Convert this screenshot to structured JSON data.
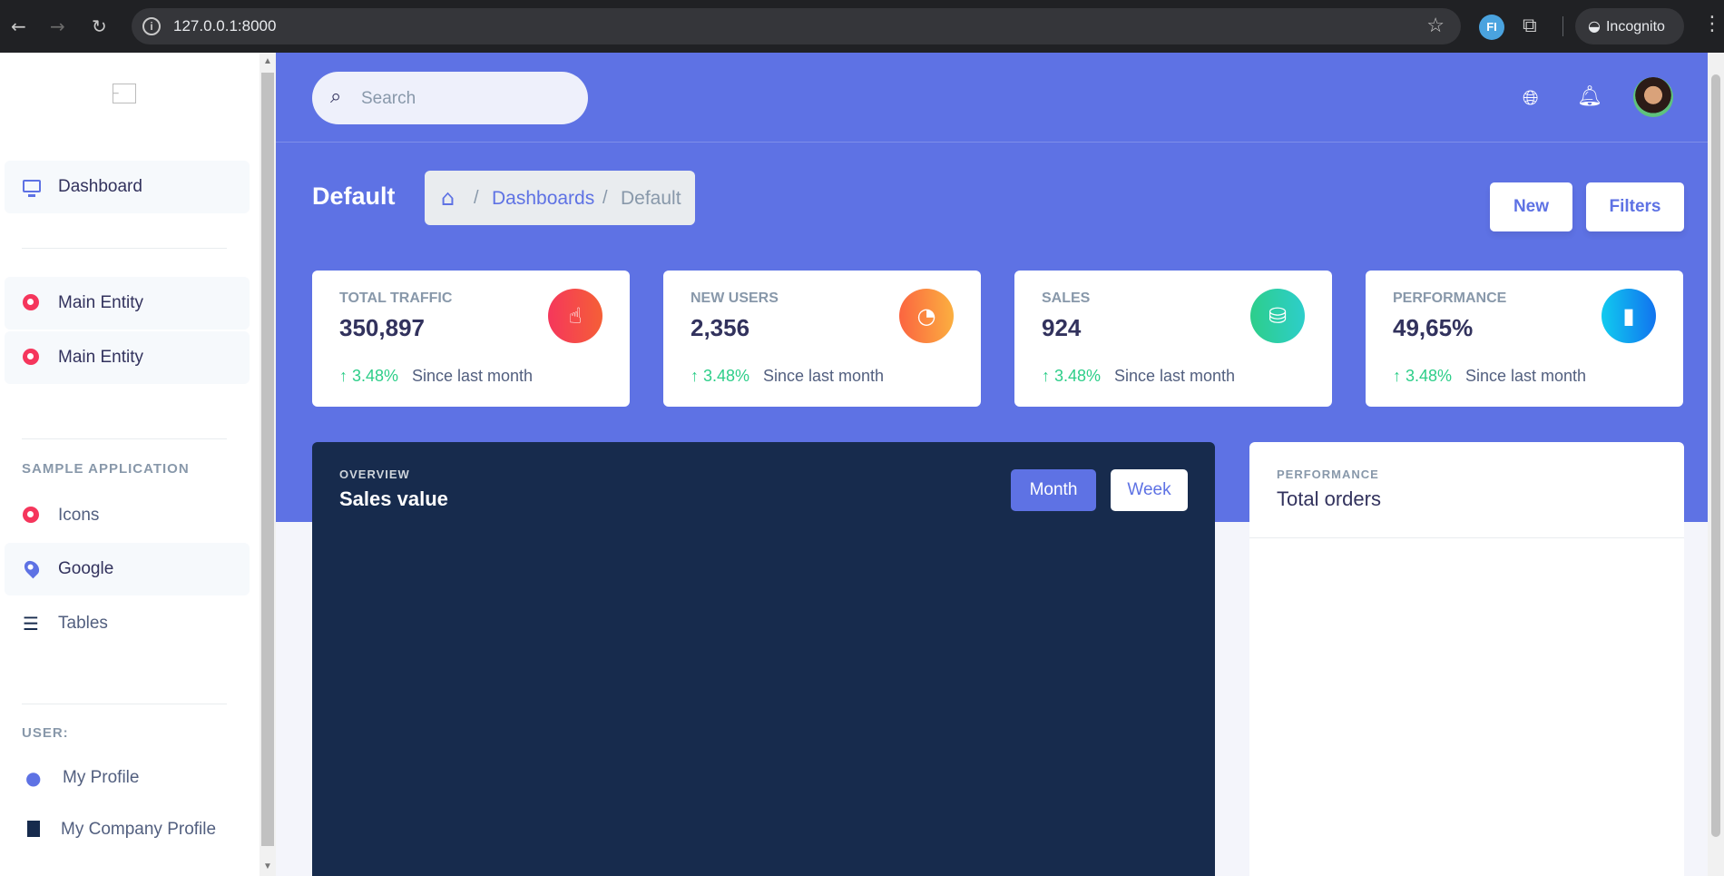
{
  "browser": {
    "url": "127.0.0.1:8000",
    "incognito_label": "Incognito",
    "extension_label": "FI"
  },
  "sidebar": {
    "logo_alt": "_",
    "items_top": [
      {
        "label": "Dashboard",
        "icon": "monitor-icon"
      }
    ],
    "entities": [
      {
        "label": "Main Entity",
        "icon": "entity-icon"
      },
      {
        "label": "Main Entity",
        "icon": "entity-icon"
      }
    ],
    "sample_heading": "SAMPLE APPLICATION",
    "sample_items": [
      {
        "label": "Icons",
        "icon": "entity-icon"
      },
      {
        "label": "Google",
        "icon": "map-pin-icon"
      },
      {
        "label": "Tables",
        "icon": "list-icon"
      }
    ],
    "user_heading": "USER:",
    "user_items": [
      {
        "label": "My Profile",
        "icon": "user-icon"
      },
      {
        "label": "My Company Profile",
        "icon": "building-icon"
      }
    ]
  },
  "topbar": {
    "search_placeholder": "Search"
  },
  "header": {
    "title": "Default",
    "breadcrumb": [
      "Dashboards",
      "Default"
    ],
    "new_label": "New",
    "filters_label": "Filters"
  },
  "stats": [
    {
      "title": "TOTAL TRAFFIC",
      "value": "350,897",
      "change": "3.48%",
      "since": "Since last month",
      "icon": "hand-pointer-icon",
      "color": "#f5365c"
    },
    {
      "title": "NEW USERS",
      "value": "2,356",
      "change": "3.48%",
      "since": "Since last month",
      "icon": "pie-chart-icon",
      "color": "#fb6340"
    },
    {
      "title": "SALES",
      "value": "924",
      "change": "3.48%",
      "since": "Since last month",
      "icon": "money-coins-icon",
      "color": "#2dce89"
    },
    {
      "title": "PERFORMANCE",
      "value": "49,65%",
      "change": "3.48%",
      "since": "Since last month",
      "icon": "bar-chart-icon",
      "color": "#11cdef"
    }
  ],
  "sales_card": {
    "overline": "OVERVIEW",
    "title": "Sales value",
    "month_label": "Month",
    "week_label": "Week"
  },
  "orders_card": {
    "overline": "PERFORMANCE",
    "title": "Total orders"
  },
  "colors": {
    "primary": "#5e72e4",
    "success": "#2dce89",
    "dark": "#172b4d"
  }
}
